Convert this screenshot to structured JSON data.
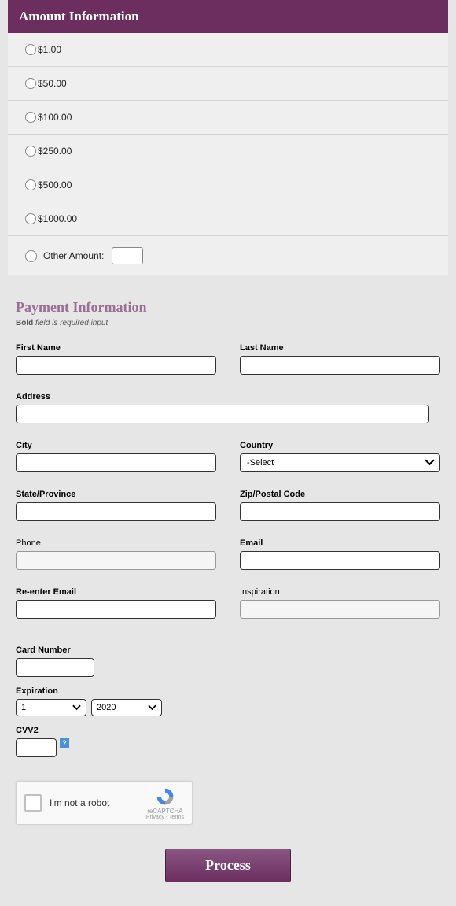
{
  "colors": {
    "purple": "#6b2e5f",
    "purple_light": "#9a6f94"
  },
  "amount_section": {
    "header": "Amount Information",
    "options": [
      "$1.00",
      "$50.00",
      "$100.00",
      "$250.00",
      "$500.00",
      "$1000.00"
    ],
    "other_label": "Other Amount:",
    "other_value": ""
  },
  "payment_section": {
    "title": "Payment Information",
    "required_note_bold": "Bold",
    "required_note_rest": " field is required input",
    "fields": {
      "first_name": {
        "label": "First Name",
        "bold": true,
        "value": ""
      },
      "last_name": {
        "label": "Last Name",
        "bold": true,
        "value": ""
      },
      "address": {
        "label": "Address",
        "bold": true,
        "value": ""
      },
      "city": {
        "label": "City",
        "bold": true,
        "value": ""
      },
      "country": {
        "label": "Country",
        "bold": true,
        "value": "-Select"
      },
      "state": {
        "label": "State/Province",
        "bold": true,
        "value": ""
      },
      "zip": {
        "label": "Zip/Postal Code",
        "bold": true,
        "value": ""
      },
      "phone": {
        "label": "Phone",
        "bold": false,
        "value": ""
      },
      "email": {
        "label": "Email",
        "bold": true,
        "value": ""
      },
      "reenter_email": {
        "label": "Re-enter Email",
        "bold": true,
        "value": ""
      },
      "inspiration": {
        "label": "Inspiration",
        "bold": false,
        "value": ""
      },
      "card_number": {
        "label": "Card Number",
        "bold": true,
        "value": ""
      },
      "expiration": {
        "label": "Expiration",
        "bold": true,
        "month": "1",
        "year": "2020"
      },
      "cvv2": {
        "label": "CVV2",
        "bold": true,
        "value": ""
      }
    }
  },
  "recaptcha": {
    "label": "I'm not a robot",
    "brand": "reCAPTCHA",
    "terms": "Privacy - Terms"
  },
  "buttons": {
    "process": "Process"
  },
  "icons": {
    "help": "?",
    "chevron_down": "chevron-down-icon"
  }
}
